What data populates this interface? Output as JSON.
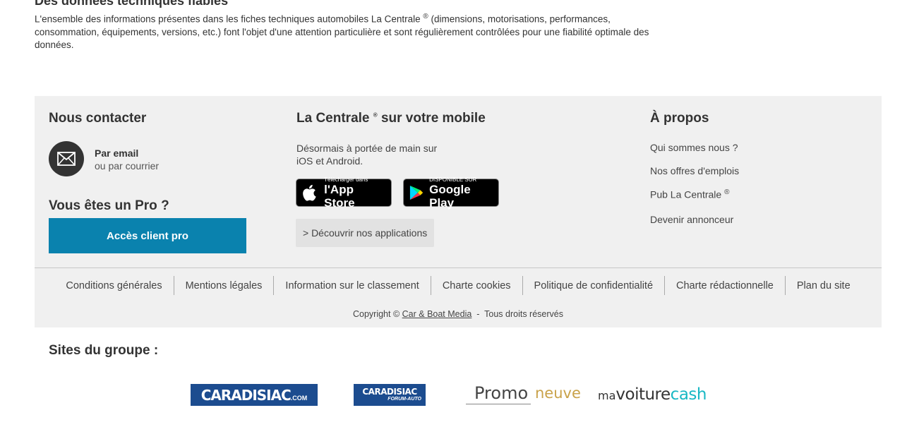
{
  "intro": {
    "title": "Des données techniques fiables",
    "text_part1": "L'ensemble des informations présentes dans les fiches techniques automobiles La Centrale",
    "reg": "®",
    "text_part2": " (dimensions, motorisations, performances, consommation, équipements, versions, etc.) font l'objet d'une attention particulière et sont régulièrement contrôlées pour une fiabilité optimale des données."
  },
  "contact": {
    "title": "Nous contacter",
    "email_label": "Par email",
    "mail_label": "ou par courrier",
    "icon": "envelope-icon"
  },
  "pro": {
    "title": "Vous êtes un Pro ?",
    "button_label": "Accès client pro"
  },
  "mobile": {
    "title_part1": "La Centrale",
    "title_reg": "®",
    "title_part2": " sur votre mobile",
    "desc_line1": "Désormais à portée de main sur",
    "desc_line2": "iOS et Android.",
    "appstore_small": "Télécharger dans",
    "appstore_big": "l'App Store",
    "googleplay_small": "DISPONIBLE SUR",
    "googleplay_big": "Google Play",
    "discover_label": "> Découvrir nos applications"
  },
  "about": {
    "title": "À propos",
    "links": [
      "Qui sommes nous ?",
      "Nos offres d'emplois",
      "Pub La Centrale",
      "Devenir annonceur"
    ],
    "reg": "®"
  },
  "legal": {
    "links": [
      "Conditions générales",
      "Mentions légales",
      "Information sur le classement",
      "Charte cookies",
      "Politique de confidentialité",
      "Charte rédactionnelle",
      "Plan du site"
    ],
    "copyright_prefix": "Copyright © ",
    "copyright_link": "Car & Boat Media",
    "copyright_suffix": "  -  Tous droits réservés"
  },
  "group": {
    "title": "Sites du groupe :",
    "logos": {
      "caradisiac": "CARADISIAC",
      "caradisiac_com": ".COM",
      "forum": "CARADISIAC",
      "forum_sub": "FORUM-AUTO",
      "promo_part1": "Promo",
      "promo_part2": "neuve",
      "mvc_part1": "ma",
      "mvc_part2": "voiture",
      "mvc_part3": "cash"
    }
  },
  "colors": {
    "accent": "#0a82ae",
    "footer_bg": "#f0f0f0",
    "caradisiac_blue": "#1c4c8f",
    "promo_gold": "#c9a24a",
    "cash_teal": "#19b8c4"
  }
}
